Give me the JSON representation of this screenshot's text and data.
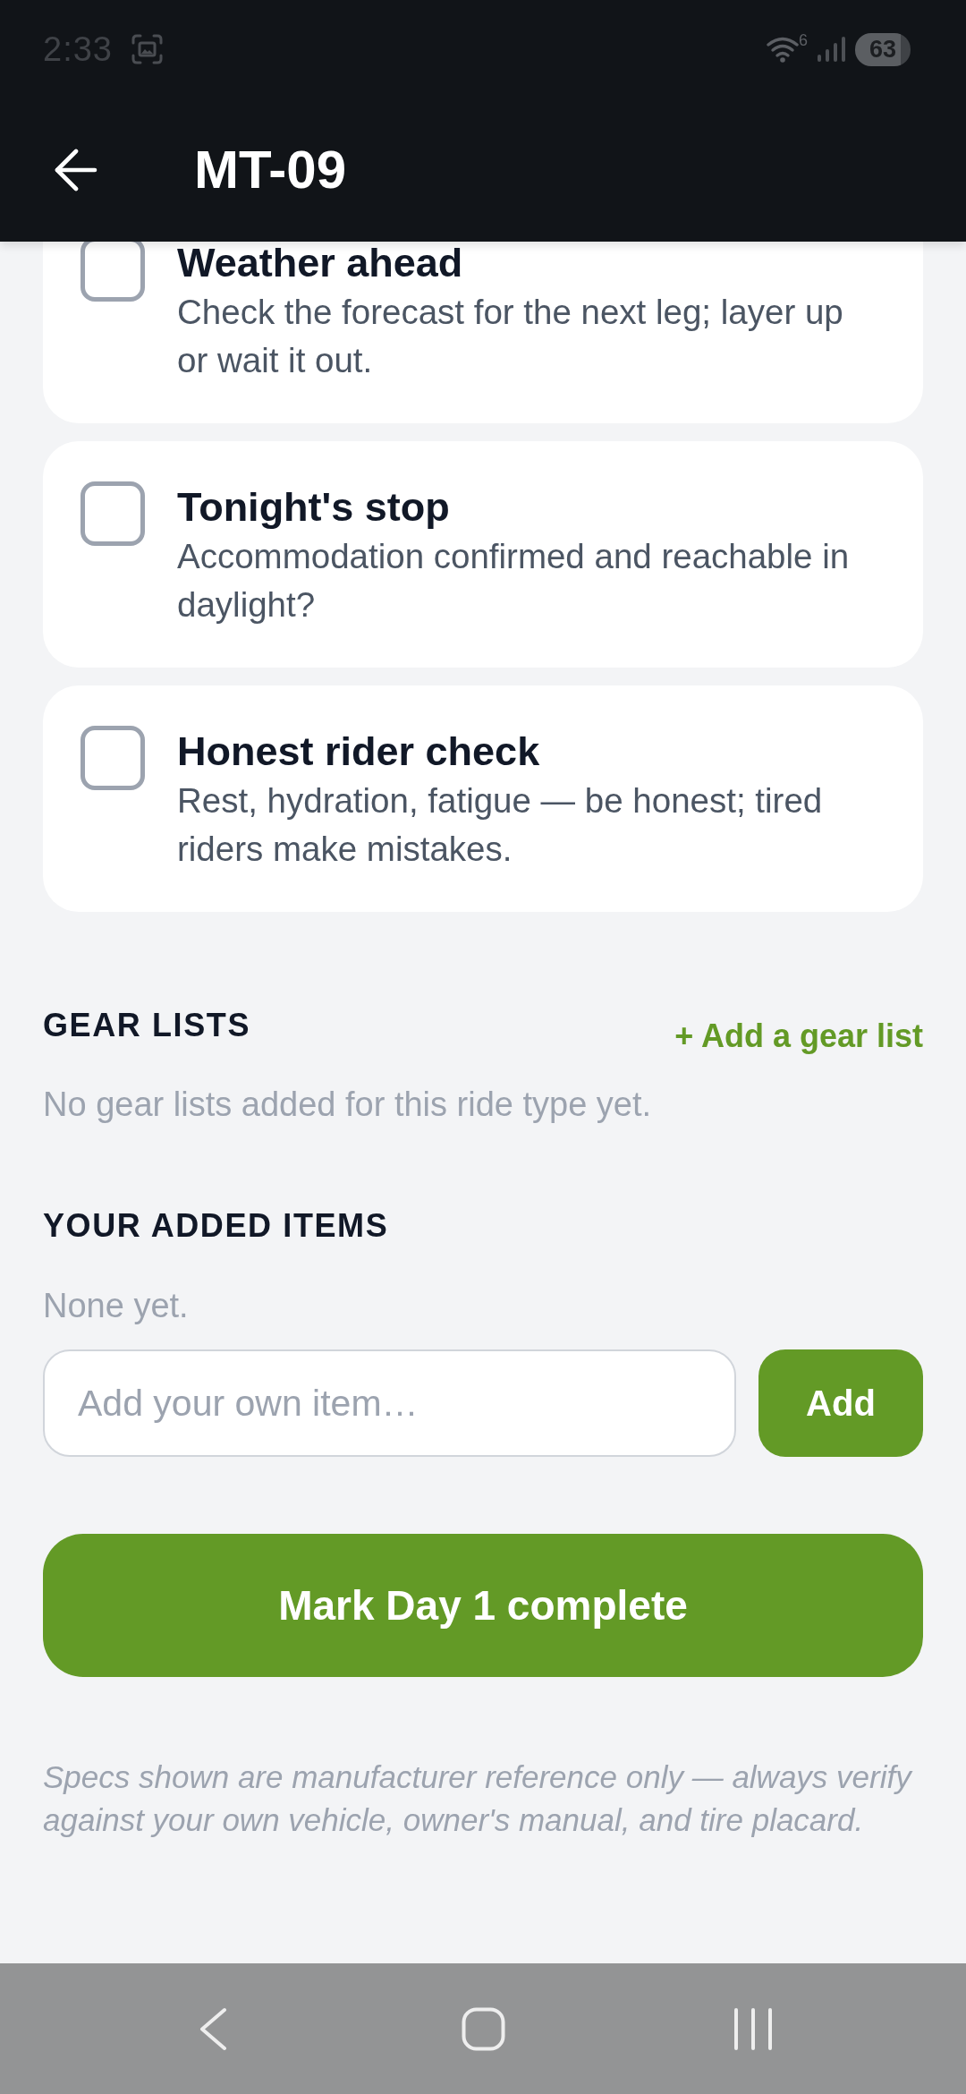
{
  "status_bar": {
    "time": "2:33",
    "wifi_badge": "6",
    "battery": "63"
  },
  "app_bar": {
    "title": "MT-09"
  },
  "checklist": [
    {
      "title": "Weather ahead",
      "description": "Check the forecast for the next leg; layer up or wait it out.",
      "checked": false
    },
    {
      "title": "Tonight's stop",
      "description": "Accommodation confirmed and reachable in daylight?",
      "checked": false
    },
    {
      "title": "Honest rider check",
      "description": "Rest, hydration, fatigue — be honest; tired riders make mistakes.",
      "checked": false
    }
  ],
  "gear_lists": {
    "heading": "GEAR LISTS",
    "add_link": "+ Add a gear list",
    "empty_text": "No gear lists added for this ride type yet."
  },
  "added_items": {
    "heading": "YOUR ADDED ITEMS",
    "empty_text": "None yet.",
    "input": {
      "placeholder": "Add your own item…"
    },
    "add_button": "Add"
  },
  "complete_button": "Mark Day 1 complete",
  "disclaimer": "Specs shown are manufacturer reference only — always verify against your own vehicle, owner's manual, and tire placard."
}
